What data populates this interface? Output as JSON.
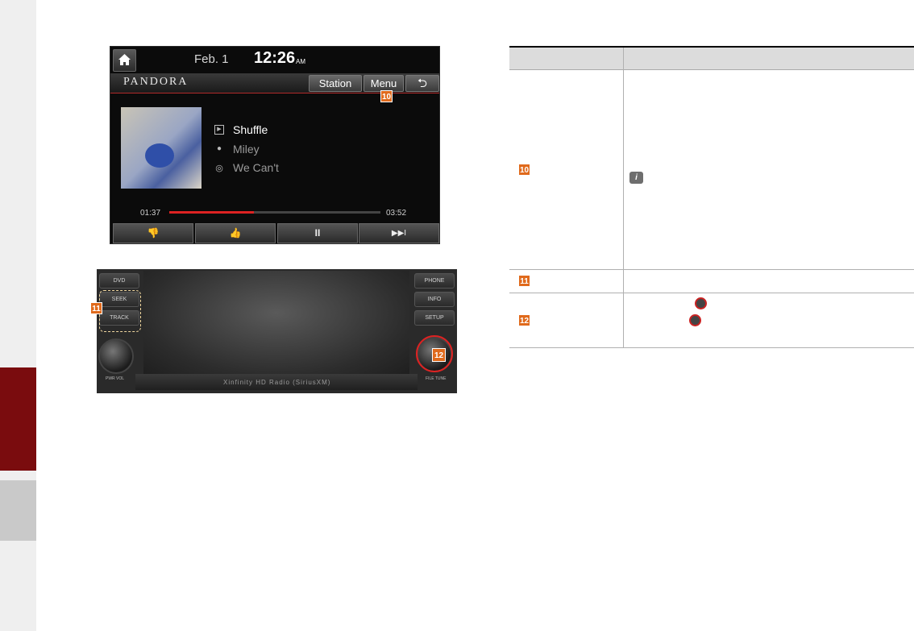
{
  "screen": {
    "date": "Feb.  1",
    "time": "12:26",
    "ampm": "AM",
    "brand": "PANDORA",
    "buttons": {
      "station": "Station",
      "menu": "Menu",
      "back": "⮌"
    },
    "track": {
      "station": "Shuffle",
      "artist": "Miley",
      "song": "We Can't"
    },
    "elapsed": "01:37",
    "duration": "03:52",
    "progress_fraction": 0.4,
    "controls": {
      "thumbs_down": "👎",
      "thumbs_up": "👍",
      "pause": "II",
      "next": "▶▶I"
    }
  },
  "badges": {
    "b10": "10",
    "b11": "11",
    "b12": "12"
  },
  "hardware": {
    "left_buttons": {
      "dvd": "DVD",
      "seek": "SEEK",
      "track": "TRACK"
    },
    "right_buttons": {
      "phone": "PHONE",
      "info": "INFO",
      "setup": "SETUP"
    },
    "left_knob": "PWR VOL",
    "right_knob": "FILE TUNE",
    "footer": "Xinfinity HD Radio (SiriusXM)"
  },
  "table": {
    "header_col1": "",
    "header_col2": "",
    "rows": [
      {
        "badge": "10"
      },
      {
        "badge": "11"
      },
      {
        "badge": "12"
      }
    ],
    "info_icon": "i"
  },
  "colors": {
    "accent_red": "#7a0c0e",
    "badge_orange": "#e06a1c",
    "progress_red": "#dd2222"
  }
}
